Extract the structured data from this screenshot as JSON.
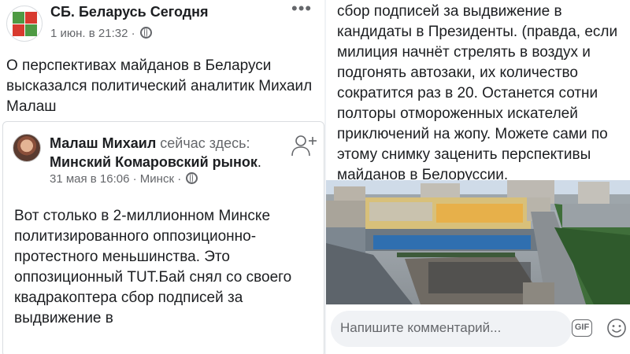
{
  "post": {
    "page_name": "СБ. Беларусь Сегодня",
    "meta": "1 июн. в 21:32 ·",
    "more_icon": "more-dots-icon",
    "text": "О перспективах майданов в Беларуси высказался политический аналитик Михаил Малаш"
  },
  "shared": {
    "author": "Малаш Михаил",
    "status": "сейчас здесь:",
    "location": "Минский Комаровский рынок",
    "period": ".",
    "meta": "31 мая в 16:06 · Минск ·",
    "text_top": "Вот столько в 2-миллионном Минске политизированного оппозиционно-протестного меньшинства. Это оппозиционный ТUT.Бай  снял со своего квадракоптера сбор подписей за выдвижение в",
    "text_bottom": "сбор подписей за выдвижение в кандидаты в Президенты. (правда, если милиция начнёт стрелять в воздух и подгонять автозаки, их количество сократится раз в 20. Останется сотни полторы отмороженных искателей приключений на жопу.  Можете сами по этому снимку заценить перспективы майданов в Белоруссии."
  },
  "comment": {
    "placeholder": "Напишите комментарий...",
    "gif_label": "GIF"
  },
  "colors": {
    "text": "#1c1e21",
    "secondary": "#65676b",
    "divider": "#dadde1",
    "logo_green": "#4e9a43",
    "logo_red": "#d83a2e"
  }
}
